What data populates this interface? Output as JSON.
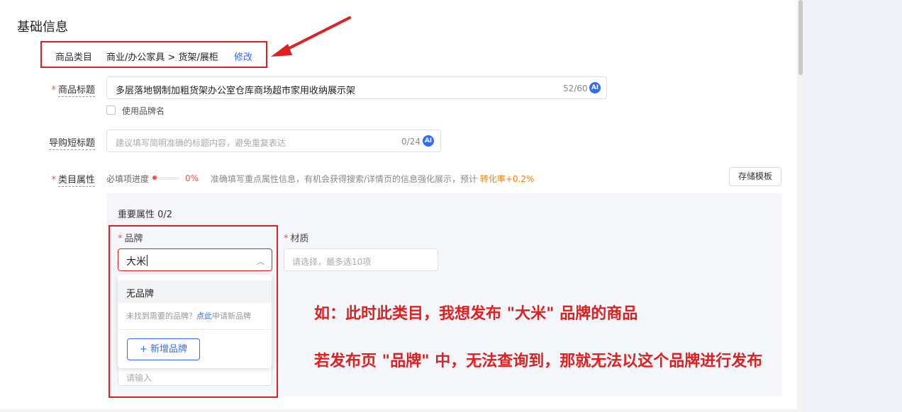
{
  "section_title": "基础信息",
  "category": {
    "label": "商品类目",
    "value": "商业/办公家具 > 货架/展柜",
    "edit": "修改"
  },
  "title_field": {
    "label": "商品标题",
    "value": "多层落地钢制加粗货架办公室仓库商场超市家用收纳展示架",
    "counter": "52/60",
    "ai": "AI"
  },
  "use_brand": {
    "label": "使用品牌名"
  },
  "short_title": {
    "label": "导购短标题",
    "placeholder": "建议填写简明准确的标题内容，避免重复表达",
    "counter": "0/24",
    "ai": "AI"
  },
  "attributes": {
    "label": "类目属性",
    "progress_label": "必填项进度",
    "progress_value": 0,
    "progress_text": "0%",
    "hint": "准确填写重点属性信息，有机会获得搜索/详情页的信息强化展示，预计",
    "hint_highlight": "转化率+0.2%",
    "template_button": "存储模板",
    "important_title": "重要属性 0/2",
    "brand_label": "品牌",
    "brand_value": "大米",
    "material_label": "材质",
    "material_placeholder": "请选择，最多选10项",
    "other_placeholder": "请输入"
  },
  "dropdown": {
    "no_brand": "无品牌",
    "tip_prefix": "未找到需要的品牌？",
    "tip_link": "点此",
    "tip_suffix": "申请新品牌",
    "add_button": "+ 新增品牌"
  },
  "annotations": {
    "line1": "如：此时此类目，我想发布 \"大米\" 品牌的商品",
    "line2": "若发布页 \"品牌\" 中，无法查询到，那就无法以这个品牌进行发布"
  },
  "colors": {
    "accent": "#2f6bff",
    "required": "#ff4d4f",
    "annotation": "#e02020",
    "highlight": "#ff7a00"
  }
}
